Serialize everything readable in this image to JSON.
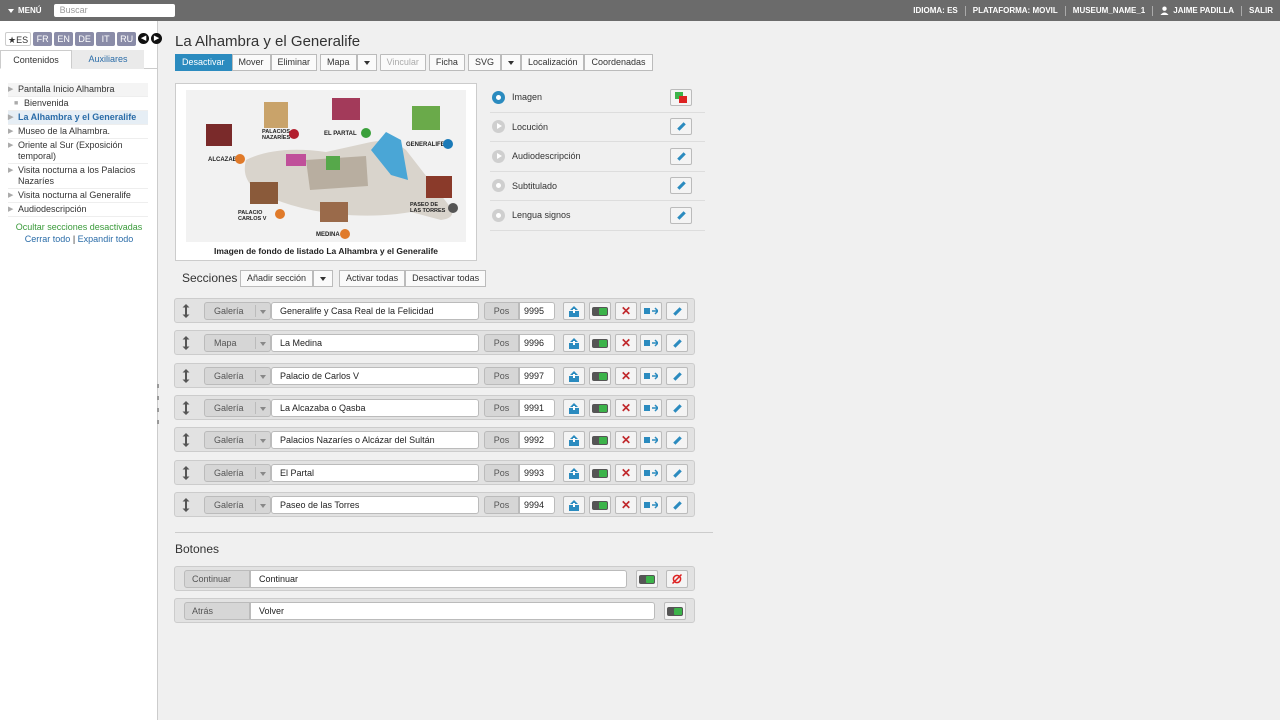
{
  "topbar": {
    "menu_label": "MENÚ",
    "search_placeholder": "Buscar",
    "right_items": [
      "IDIOMA: ES",
      "PLATAFORMA: MOVIL",
      "MUSEUM_NAME_1",
      "JAIME PADILLA",
      "SALIR"
    ]
  },
  "sidebar": {
    "languages": [
      {
        "code": "ES",
        "active": true
      },
      {
        "code": "FR"
      },
      {
        "code": "EN"
      },
      {
        "code": "DE"
      },
      {
        "code": "IT"
      },
      {
        "code": "RU"
      }
    ],
    "tabs": [
      "Contenidos",
      "Auxiliares"
    ],
    "tree": [
      "Pantalla Inicio Alhambra",
      "Bienvenida",
      "La Alhambra y el Generalife",
      "Museo de la Alhambra.",
      "Oriente al Sur (Exposición temporal)",
      "Visita nocturna a los Palacios Nazaríes",
      "Visita nocturna al Generalife",
      "Audiodescripción"
    ],
    "hide_disabled": "Ocultar secciones desactivadas",
    "collapse_all": "Cerrar todo",
    "sep": "|",
    "expand_all": "Expandir todo"
  },
  "page": {
    "title": "La Alhambra y el Generalife",
    "toolbar": {
      "deactivate": "Desactivar",
      "move": "Mover",
      "delete": "Eliminar",
      "map": "Mapa",
      "link": "Vincular",
      "sheet": "Ficha",
      "svg": "SVG",
      "location": "Localización",
      "coordinates": "Coordenadas"
    },
    "preview_caption": "Imagen de fondo de listado La Alhambra y el Generalife",
    "map_labels": {
      "alcazaba": "ALCAZABA",
      "palacios1": "PALACIOS",
      "palacios2": "NAZARÍES",
      "partal": "EL PARTAL",
      "generalife": "GENERALIFE",
      "carlos1": "PALACIO",
      "carlos2": "CARLOS V",
      "medina": "MEDINA",
      "paseo1": "PASEO DE",
      "paseo2": "LAS TORRES"
    },
    "media": [
      "Imagen",
      "Locución",
      "Audiodescripción",
      "Subtitulado",
      "Lengua signos"
    ]
  },
  "sections": {
    "header": "Secciones",
    "add_section": "Añadir sección",
    "activate_all": "Activar todas",
    "deactivate_all": "Desactivar todas",
    "pos_label": "Pos",
    "rows": [
      {
        "type": "Galería",
        "name": "Generalife y Casa Real de la Felicidad",
        "pos": "9995"
      },
      {
        "type": "Mapa",
        "name": "La Medina",
        "pos": "9996"
      },
      {
        "type": "Galería",
        "name": "Palacio de Carlos V",
        "pos": "9997"
      },
      {
        "type": "Galería",
        "name": "La Alcazaba o Qasba",
        "pos": "9991"
      },
      {
        "type": "Galería",
        "name": "Palacios Nazaríes o Alcázar del Sultán",
        "pos": "9992"
      },
      {
        "type": "Galería",
        "name": "El Partal",
        "pos": "9993"
      },
      {
        "type": "Galería",
        "name": "Paseo de las Torres",
        "pos": "9994"
      }
    ]
  },
  "buttons": {
    "header": "Botones",
    "rows": [
      {
        "label": "Continuar",
        "value": "Continuar"
      },
      {
        "label": "Atrás",
        "value": "Volver"
      }
    ]
  }
}
